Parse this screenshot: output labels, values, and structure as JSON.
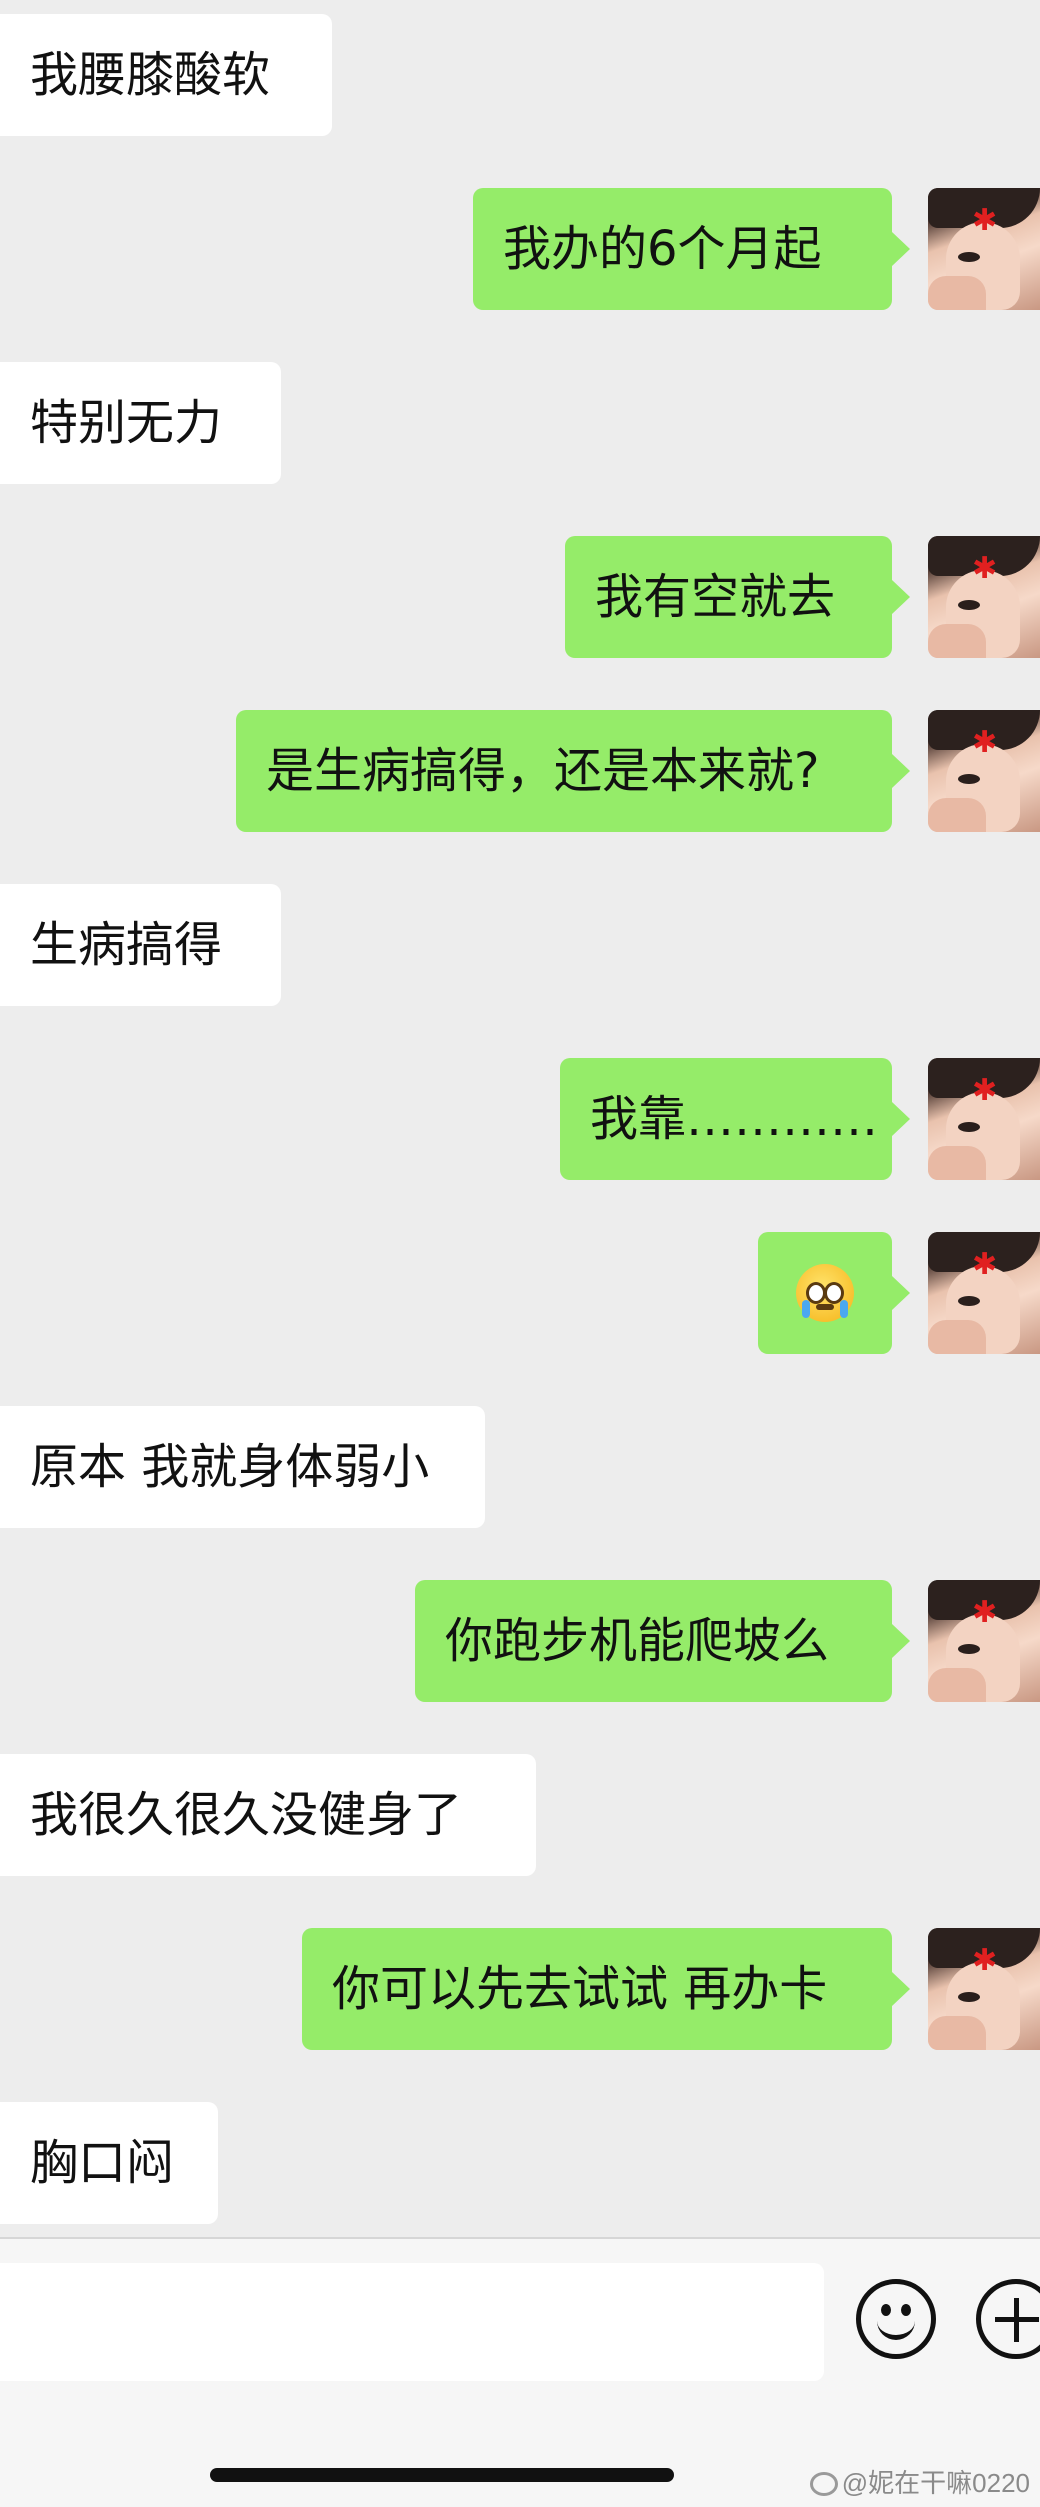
{
  "messages": [
    {
      "side": "in",
      "text": "我腰膝酸软"
    },
    {
      "side": "out",
      "text": "我办的6个月起"
    },
    {
      "side": "in",
      "text": "特别无力"
    },
    {
      "side": "out",
      "text": "我有空就去"
    },
    {
      "side": "out",
      "text": "是生病搞得，还是本来就?"
    },
    {
      "side": "in",
      "text": "生病搞得"
    },
    {
      "side": "out",
      "text": "我靠…………"
    },
    {
      "side": "out",
      "text": "",
      "emoji": "crying-face-emoji"
    },
    {
      "side": "in",
      "text": "原本 我就身体弱小"
    },
    {
      "side": "out",
      "text": "你跑步机能爬坡么"
    },
    {
      "side": "in",
      "text": "我很久很久没健身了"
    },
    {
      "side": "out",
      "text": "你可以先去试试 再办卡"
    },
    {
      "side": "in",
      "text": "胸口闷"
    }
  ],
  "input": {
    "value": ""
  },
  "watermark": "@妮在干嘛0220",
  "colors": {
    "outgoing_bubble": "#95ec69",
    "incoming_bubble": "#ffffff",
    "background": "#ededed"
  }
}
